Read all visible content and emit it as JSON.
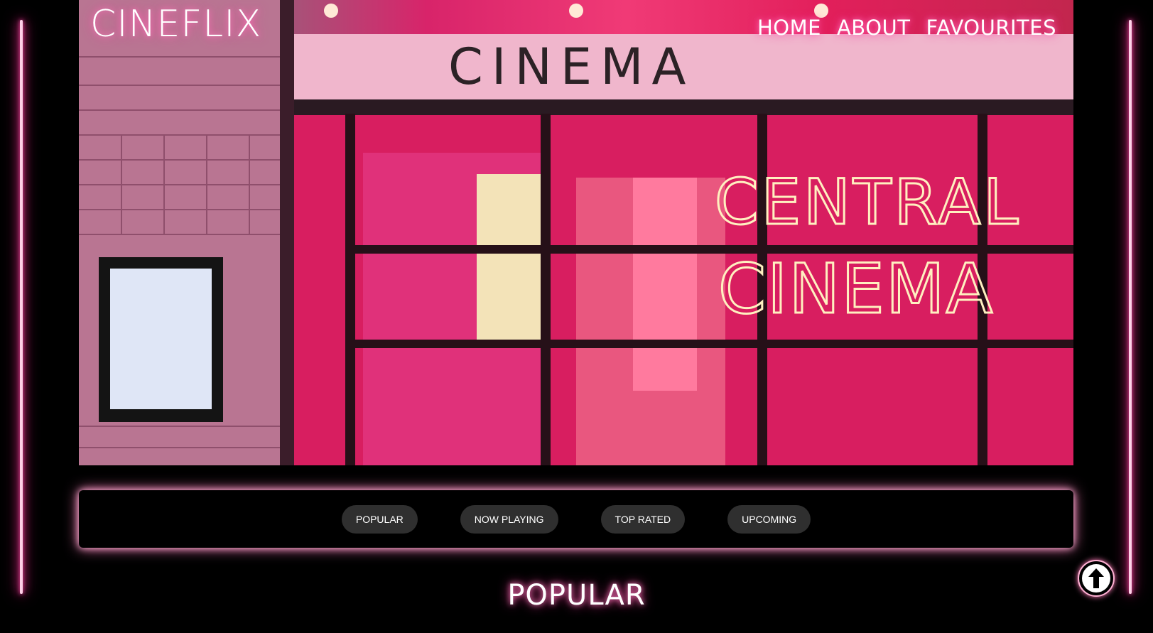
{
  "header": {
    "brand": "CINEFLIX",
    "nav": [
      {
        "label": "HOME"
      },
      {
        "label": "ABOUT"
      },
      {
        "label": "FAVOURITES"
      }
    ]
  },
  "hero": {
    "marquee_text": "CINEMA",
    "neon_sign_line1": "CENTRAL",
    "neon_sign_line2": "CINEMA"
  },
  "categories": [
    {
      "label": "POPULAR"
    },
    {
      "label": "NOW PLAYING"
    },
    {
      "label": "TOP RATED"
    },
    {
      "label": "UPCOMING"
    }
  ],
  "section": {
    "title": "POPULAR"
  },
  "scroll_top": {
    "icon": "arrow-up-icon"
  },
  "colors": {
    "neon_pink": "#ff3f9e",
    "background": "#000000",
    "button_bg": "#2f2f2f"
  }
}
